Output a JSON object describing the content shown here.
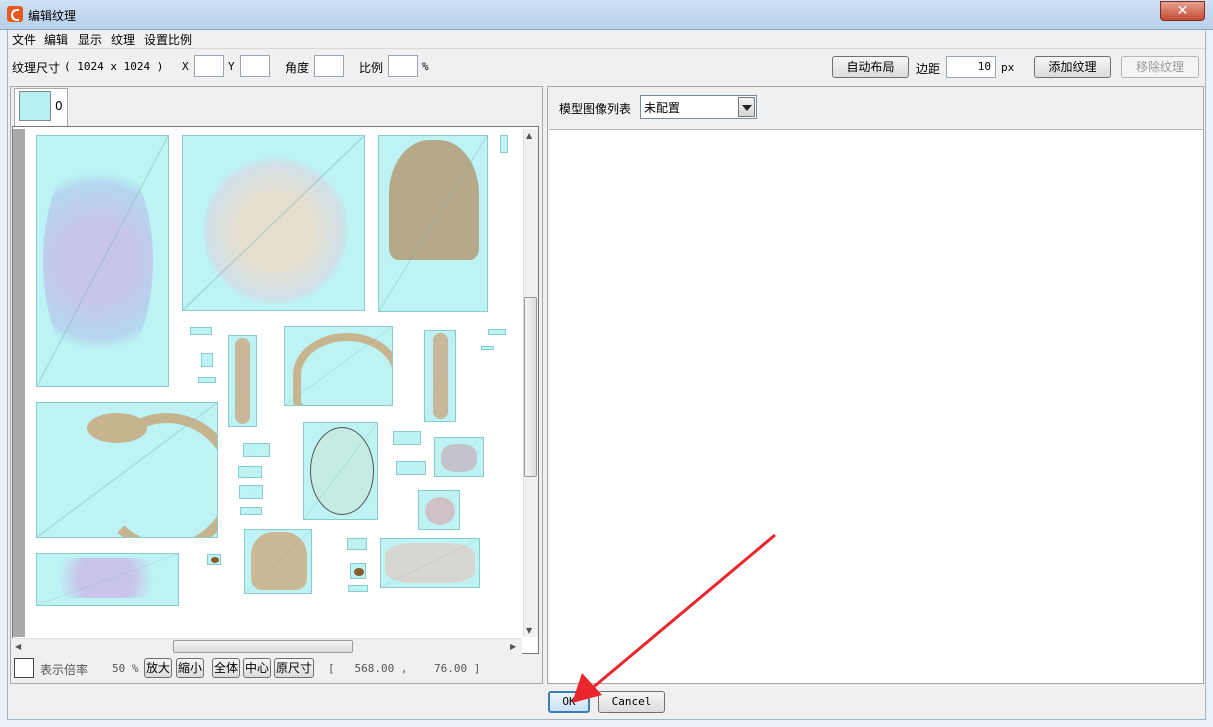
{
  "window": {
    "title": "编辑纹理",
    "close_label": "✕"
  },
  "menu": [
    "文件",
    "编辑",
    "显示",
    "纹理",
    "设置比例"
  ],
  "toolbar": {
    "texture_size_label": "纹理尺寸",
    "texture_size_value": "( 1024 x 1024 )",
    "x_label": "X",
    "x_value": "",
    "y_label": "Y",
    "y_value": "",
    "angle_label": "角度",
    "angle_value": "",
    "scale_label": "比例",
    "scale_value": "",
    "scale_unit": "%",
    "auto_layout_label": "自动布局",
    "margin_label": "边距",
    "margin_value": "10",
    "margin_unit": "px",
    "add_texture_label": "添加纹理",
    "remove_texture_label": "移除纹理"
  },
  "texture_tabs": [
    {
      "label": "0"
    }
  ],
  "zoom_bar": {
    "zoom_label": "表示倍率",
    "zoom_value": "50 %",
    "zoom_in_label": "放大",
    "zoom_out_label": "縮小",
    "fit_all_label": "全体",
    "center_label": "中心",
    "original_size_label": "原尺寸",
    "coords": "[   568.00 ,    76.00 ]"
  },
  "right_panel": {
    "model_image_list_label": "模型图像列表",
    "model_image_list_value": "未配置"
  },
  "dialog": {
    "ok_label": "OK",
    "cancel_label": "Cancel"
  },
  "colors": {
    "tile_fill": "#bdf3f4",
    "annotation_arrow": "#e8262b",
    "close_button": "#c54b34"
  }
}
